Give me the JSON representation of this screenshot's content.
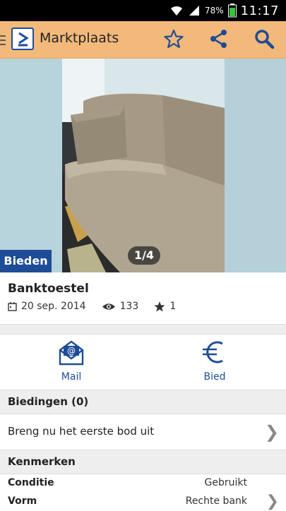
{
  "status": {
    "battery": "78%",
    "time": "11:17"
  },
  "appbar": {
    "title": "Marktplaats",
    "icons": [
      "star-icon",
      "share-icon",
      "search-icon"
    ]
  },
  "photo": {
    "counter": "1/4",
    "bid_tag": "Bieden"
  },
  "item": {
    "title": "Banktoestel",
    "date": "20 sep. 2014",
    "views": "133",
    "favorites": "1"
  },
  "actions": [
    {
      "label": "Mail",
      "icon": "mail-icon"
    },
    {
      "label": "Bied",
      "icon": "euro-icon"
    }
  ],
  "bids": {
    "header": "Biedingen (0)",
    "cta": "Breng nu het eerste bod uit"
  },
  "features": {
    "header": "Kenmerken",
    "rows": [
      {
        "key": "Conditie",
        "value": "Gebruikt"
      },
      {
        "key": "Vorm",
        "value": "Rechte bank"
      }
    ]
  },
  "colors": {
    "appbar": "#f3b97b",
    "brand_blue": "#1e4c96"
  }
}
